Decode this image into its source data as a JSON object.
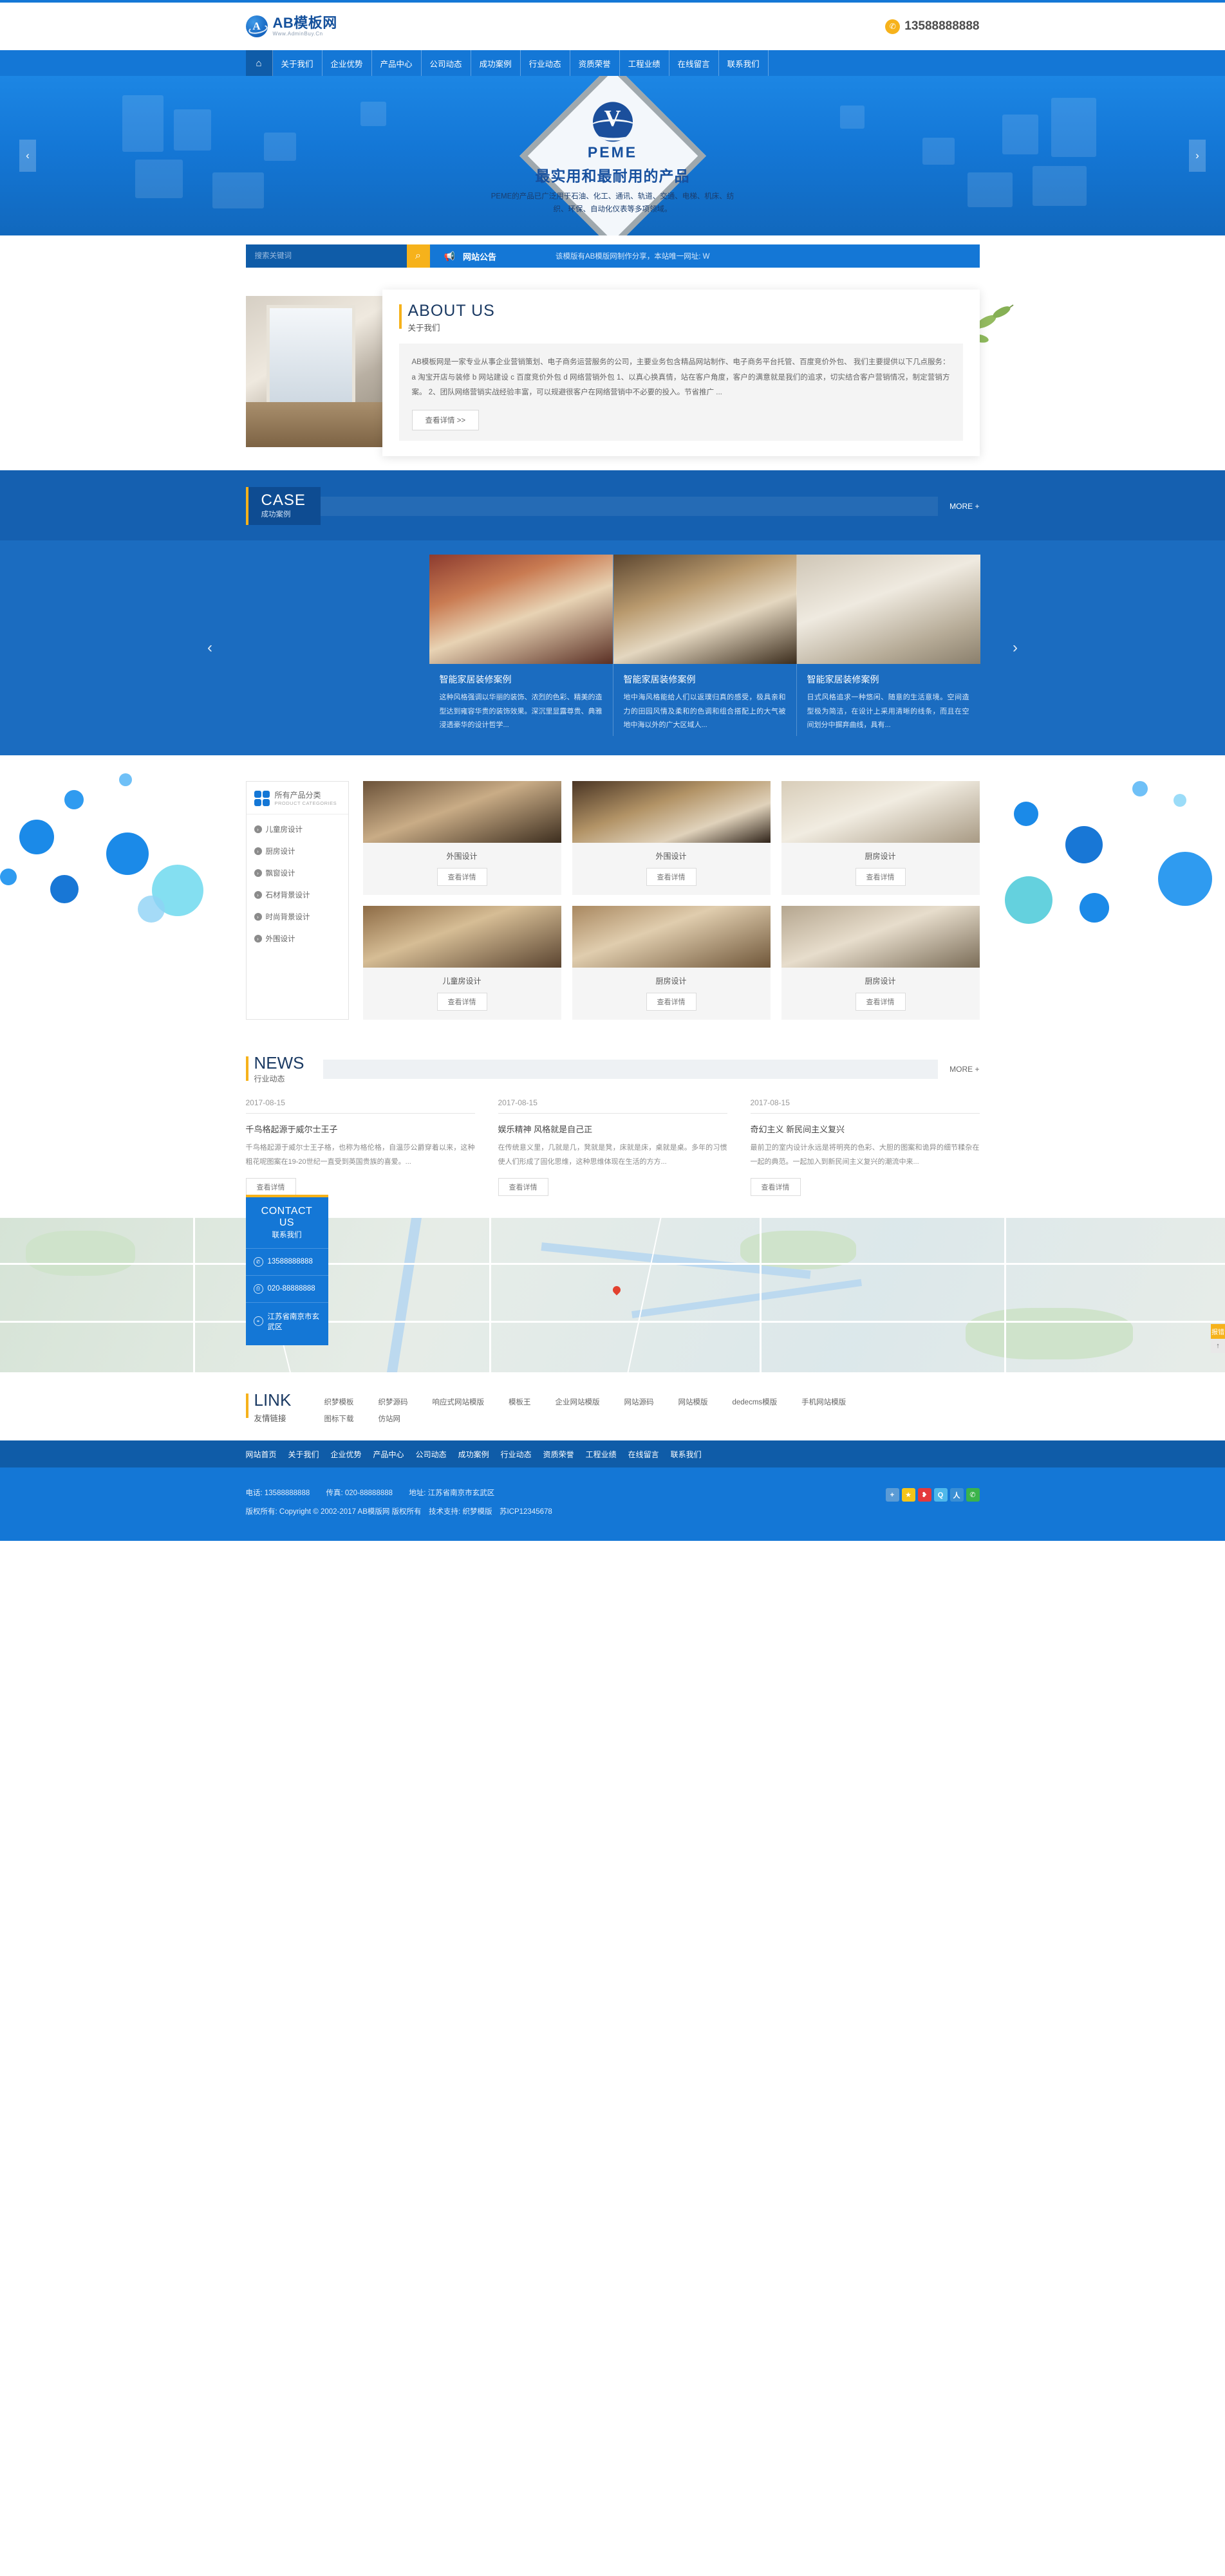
{
  "brand": {
    "name": "AB模板网",
    "domain": "Www.AdminBuy.Cn",
    "phone": "13588888888"
  },
  "nav": {
    "home_icon": "home-icon",
    "items": [
      "关于我们",
      "企业优势",
      "产品中心",
      "公司动态",
      "成功案例",
      "行业动态",
      "资质荣誉",
      "工程业绩",
      "在线留言",
      "联系我们"
    ]
  },
  "banner": {
    "logo_text": "PEME",
    "headline": "最实用和最耐用的产品",
    "desc": "PEME的产品已广泛用于石油、化工、通讯、轨道、交通、电梯、机床、纺织、环保、自动化仪表等多项领域。",
    "prev": "‹",
    "next": "›"
  },
  "search": {
    "placeholder": "搜索关键词",
    "button_icon": "search-icon"
  },
  "notice": {
    "icon": "megaphone-icon",
    "title": "网站公告",
    "text": "该模版有AB模版网制作分享，本站唯一网址: W"
  },
  "about": {
    "en": "ABOUT US",
    "cn": "关于我们",
    "text": "AB模板网是一家专业从事企业营销策划、电子商务运营服务的公司，主要业务包含精品网站制作、电子商务平台托管、百度竞价外包、 我们主要提供以下几点服务： a 淘宝开店与装修 b 网站建设 c 百度竞价外包 d 网络营销外包 1、以真心换真情，站在客户角度，客户的满意就是我们的追求，切实结合客户营销情况，制定营销方案。 2、团队网络营销实战经验丰富，可以规避很客户在网络营销中不必要的投入。节省推广 ...",
    "button": "查看详情 >>"
  },
  "case": {
    "en": "CASE",
    "cn": "成功案例",
    "more": "MORE +",
    "prev": "‹",
    "next": "›",
    "items": [
      {
        "title": "智能家居装修案例",
        "desc": "这种风格强调以华丽的装饰、浓烈的色彩、精美的造型达到雍容华贵的装饰效果。深沉里显露尊贵、典雅浸透豪华的设计哲学..."
      },
      {
        "title": "智能家居装修案例",
        "desc": "地中海风格能给人们以返璞归真的感受，极具亲和力的田园风情及柔和的色调和组合搭配上的大气被地中海以外的广大区域人..."
      },
      {
        "title": "智能家居装修案例",
        "desc": "日式风格追求一种悠闲、随意的生活意境。空间造型极为简洁，在设计上采用清晰的线条，而且在空间划分中摒弃曲线，具有..."
      }
    ]
  },
  "categories": {
    "cn": "所有产品分类",
    "en": "PRODUCT CATEGORIES",
    "items": [
      "儿童房设计",
      "厨房设计",
      "飘窗设计",
      "石材背景设计",
      "时尚背景设计",
      "外围设计"
    ]
  },
  "products": {
    "button": "查看详情",
    "items": [
      {
        "name": "外围设计"
      },
      {
        "name": "外围设计"
      },
      {
        "name": "厨房设计"
      },
      {
        "name": "儿童房设计"
      },
      {
        "name": "厨房设计"
      },
      {
        "name": "厨房设计"
      }
    ]
  },
  "news": {
    "en": "NEWS",
    "cn": "行业动态",
    "more": "MORE +",
    "button": "查看详情",
    "items": [
      {
        "date": "2017-08-15",
        "title": "千鸟格起源于威尔士王子",
        "desc": "千鸟格起源于威尔士王子格，也称为格伦格，自温莎公爵穿着以来，这种粗花呢图案在19-20世纪一直受到英国贵族的喜爱。..."
      },
      {
        "date": "2017-08-15",
        "title": "娱乐精神 风格就是自己正",
        "desc": "在传统意义里，几就是几，凳就是凳，床就是床，桌就是桌。多年的习惯使人们形成了固化思维，这种思维体现在生活的方方..."
      },
      {
        "date": "2017-08-15",
        "title": "奇幻主义 新民间主义复兴",
        "desc": "最前卫的室内设计永远是将明亮的色彩、大胆的图案和诡异的细节糅杂在一起的典范。一起加入到新民间主义复兴的潮流中来..."
      }
    ]
  },
  "contact": {
    "en": "CONTACT US",
    "cn": "联系我们",
    "items": [
      {
        "icon": "phone-icon",
        "value": "13588888888"
      },
      {
        "icon": "fax-icon",
        "value": "020-88888888"
      },
      {
        "icon": "location-icon",
        "value": "江苏省南京市玄武区"
      }
    ],
    "map_badge": "报错",
    "map_up": "↑"
  },
  "links": {
    "en": "LINK",
    "cn": "友情链接",
    "items": [
      "织梦模板",
      "织梦源码",
      "响应式网站模版",
      "模板王",
      "企业网站模版",
      "网站源码",
      "网站模版",
      "dedecms模版",
      "手机网站模版",
      "图标下载",
      "仿站网"
    ]
  },
  "footer": {
    "nav": [
      "网站首页",
      "关于我们",
      "企业优势",
      "产品中心",
      "公司动态",
      "成功案例",
      "行业动态",
      "资质荣誉",
      "工程业绩",
      "在线留言",
      "联系我们"
    ],
    "contact_line": {
      "phone_label": "电话: 13588888888",
      "fax_label": "传真: 020-88888888",
      "addr_label": "地址: 江苏省南京市玄武区"
    },
    "copyright": "版权所有: Copyright © 2002-2017 AB模版网 版权所有　技术支持: 织梦模版　苏ICP12345678",
    "shares": [
      {
        "name": "share-jiathis",
        "glyph": "+",
        "color": "#5b9bd5"
      },
      {
        "name": "share-qzone",
        "glyph": "★",
        "color": "#f5c518"
      },
      {
        "name": "share-weibo",
        "glyph": "❥",
        "color": "#e4393c"
      },
      {
        "name": "share-qq",
        "glyph": "Q",
        "color": "#4fb8ea"
      },
      {
        "name": "share-renren",
        "glyph": "人",
        "color": "#3a8fd4"
      },
      {
        "name": "share-wechat",
        "glyph": "✆",
        "color": "#3bb34a"
      }
    ]
  },
  "colors": {
    "primary": "#1477d6",
    "dark": "#0f5ca8",
    "accent": "#f6b21b",
    "case_bg": "#1560b0"
  }
}
